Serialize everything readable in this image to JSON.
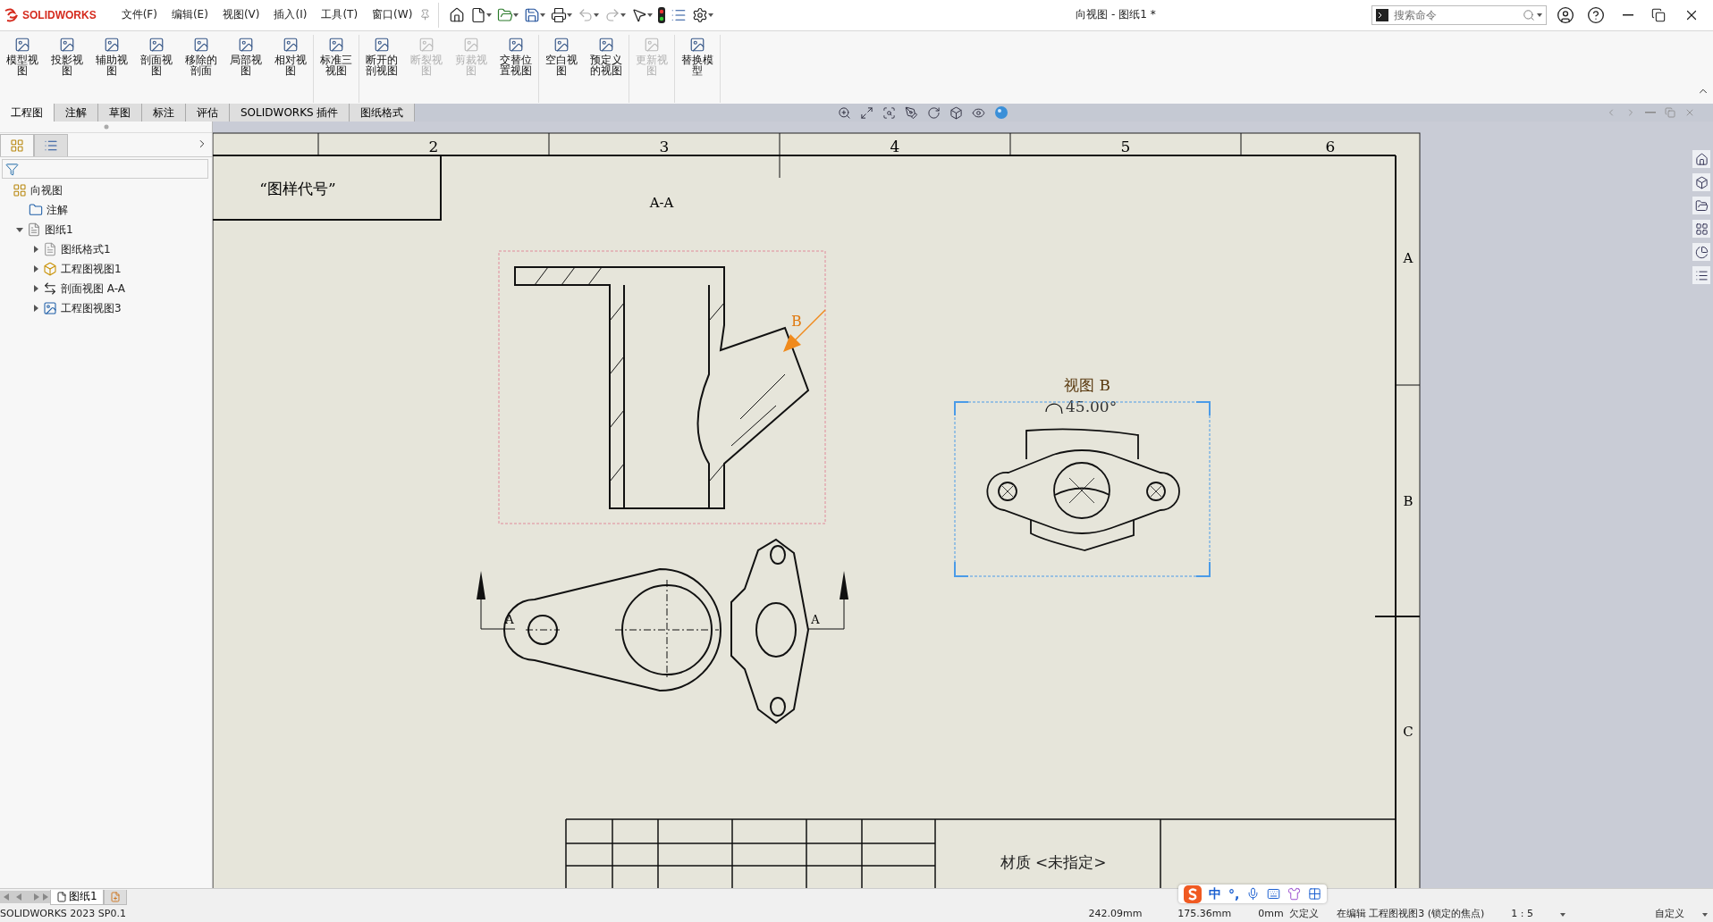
{
  "app": {
    "logo": "SOLIDWORKS"
  },
  "menus": [
    "文件(F)",
    "编辑(E)",
    "视图(V)",
    "插入(I)",
    "工具(T)",
    "窗口(W)"
  ],
  "window": {
    "title": "向视图 - 图纸1 *"
  },
  "search": {
    "placeholder": "搜索命令"
  },
  "ribbon": {
    "groups": [
      [
        {
          "label": "模型视图",
          "disabled": false
        },
        {
          "label": "投影视图",
          "disabled": false
        },
        {
          "label": "辅助视图",
          "disabled": false
        },
        {
          "label": "剖面视图",
          "disabled": false
        },
        {
          "label": "移除的剖面",
          "disabled": false
        },
        {
          "label": "局部视图",
          "disabled": false
        },
        {
          "label": "相对视图",
          "disabled": false
        }
      ],
      [
        {
          "label": "标准三视图",
          "disabled": false
        }
      ],
      [
        {
          "label": "断开的剖视图",
          "disabled": false
        },
        {
          "label": "断裂视图",
          "disabled": true
        },
        {
          "label": "剪裁视图",
          "disabled": true
        },
        {
          "label": "交替位置视图",
          "disabled": false
        }
      ],
      [
        {
          "label": "空白视图",
          "disabled": false
        },
        {
          "label": "预定义的视图",
          "disabled": false
        }
      ],
      [
        {
          "label": "更新视图",
          "disabled": true
        }
      ],
      [
        {
          "label": "替换模型",
          "disabled": false
        }
      ]
    ]
  },
  "tabs": [
    {
      "label": "工程图",
      "selected": true
    },
    {
      "label": "注解",
      "selected": false
    },
    {
      "label": "草图",
      "selected": false
    },
    {
      "label": "标注",
      "selected": false
    },
    {
      "label": "评估",
      "selected": false
    },
    {
      "label": "SOLIDWORKS 插件",
      "selected": false
    },
    {
      "label": "图纸格式",
      "selected": false
    }
  ],
  "feature_tree": {
    "items": [
      {
        "label": "向视图",
        "kind": "drawing",
        "children": [
          {
            "label": "注解",
            "kind": "annotations"
          },
          {
            "label": "图纸1",
            "kind": "sheet",
            "expanded": true,
            "children": [
              {
                "label": "图纸格式1",
                "kind": "sheet-format",
                "expanded": false
              },
              {
                "label": "工程图视图1",
                "kind": "model-view",
                "expanded": false
              },
              {
                "label": "剖面视图 A-A",
                "kind": "section-view",
                "expanded": false
              },
              {
                "label": "工程图视图3",
                "kind": "view",
                "expanded": false
              }
            ]
          }
        ]
      }
    ]
  },
  "drawing": {
    "zone_columns": [
      "2",
      "3",
      "4",
      "5",
      "6"
    ],
    "zone_rows": [
      "A",
      "B",
      "C"
    ],
    "title_block_note": "“图样代号”",
    "section_title": "A-A",
    "view_arrow_label": "B",
    "section_markers": [
      "A",
      "A"
    ],
    "detail_view": {
      "title": "视图 B",
      "rotation": "45.00°"
    },
    "material": "材质 <未指定>"
  },
  "sheet_tabs": [
    {
      "label": "图纸1",
      "selected": true
    }
  ],
  "ime": {
    "mode": "中",
    "punctuation": "°,"
  },
  "status_bar": {
    "version": "SOLIDWORKS 2023 SP0.1",
    "x": "242.09mm",
    "y": "175.36mm",
    "z": "0mm",
    "state": "欠定义",
    "editing": "在编辑 工程图视图3 (锁定的焦点)",
    "scale": "1 : 5",
    "units": "自定义"
  }
}
